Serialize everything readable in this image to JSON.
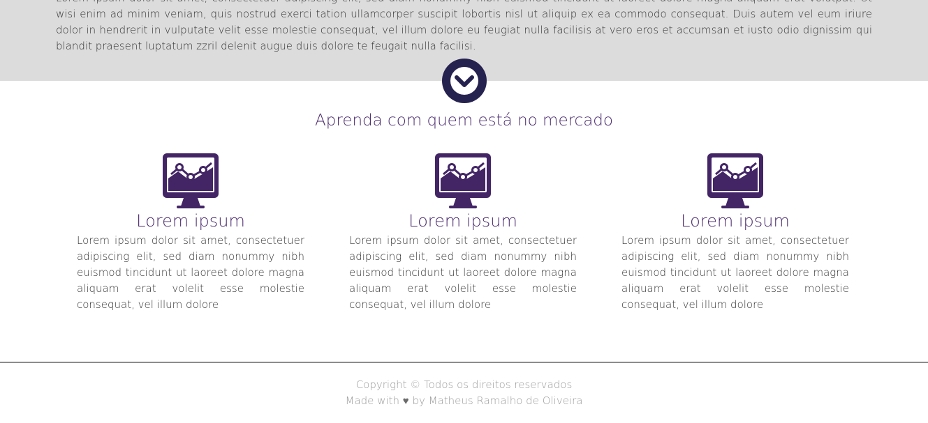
{
  "intro": {
    "text": "Lorem ipsum dolor sit amet, consectetuer adipiscing elit, sed diam nonummy nibh euismod tincidunt ut laoreet dolore magna aliquam erat volutpat. Ut wisi enim ad minim veniam, quis nostrud exerci tation ullamcorper suscipit lobortis nisl ut aliquip ex ea commodo consequat. Duis autem vel eum iriure dolor in hendrerit in vulputate velit esse molestie consequat, vel illum dolore eu feugiat nulla facilisis at vero eros et accumsan et iusto odio dignissim qui blandit praesent luptatum zzril delenit augue duis dolore te feugait nulla facilisi."
  },
  "scroll_button": {
    "icon": "chevron-down-icon"
  },
  "section": {
    "title": "Aprenda com quem está no mercado",
    "cards": [
      {
        "icon": "monitor-chart-icon",
        "title": "Lorem ipsum",
        "text": "Lorem ipsum dolor sit amet, consectetuer adipiscing elit, sed diam nonummy nibh euismod tincidunt ut laoreet dolore magna aliquam erat volelit esse molestie consequat, vel illum dolore"
      },
      {
        "icon": "monitor-chart-icon",
        "title": "Lorem ipsum",
        "text": "Lorem ipsum dolor sit amet, consectetuer adipiscing elit, sed diam nonummy nibh euismod tincidunt ut laoreet dolore magna aliquam erat volelit esse molestie consequat, vel illum dolore"
      },
      {
        "icon": "monitor-chart-icon",
        "title": "Lorem ipsum",
        "text": "Lorem ipsum dolor sit amet, consectetuer adipiscing elit, sed diam nonummy nibh euismod tincidunt ut laoreet dolore magna aliquam erat volelit esse molestie consequat, vel illum dolore"
      }
    ]
  },
  "footer": {
    "copyright": "Copyright © Todos os direitos reservados",
    "made_with_prefix": "Made with",
    "heart": "♥",
    "made_with_suffix": "by Matheus Ramalho de Oliveira"
  },
  "colors": {
    "band_background": "#dcdcdc",
    "accent_purple": "#4a2a6e",
    "icon_purple": "#432566",
    "button_navy": "#26224f",
    "footer_text": "#9a9a9a"
  }
}
